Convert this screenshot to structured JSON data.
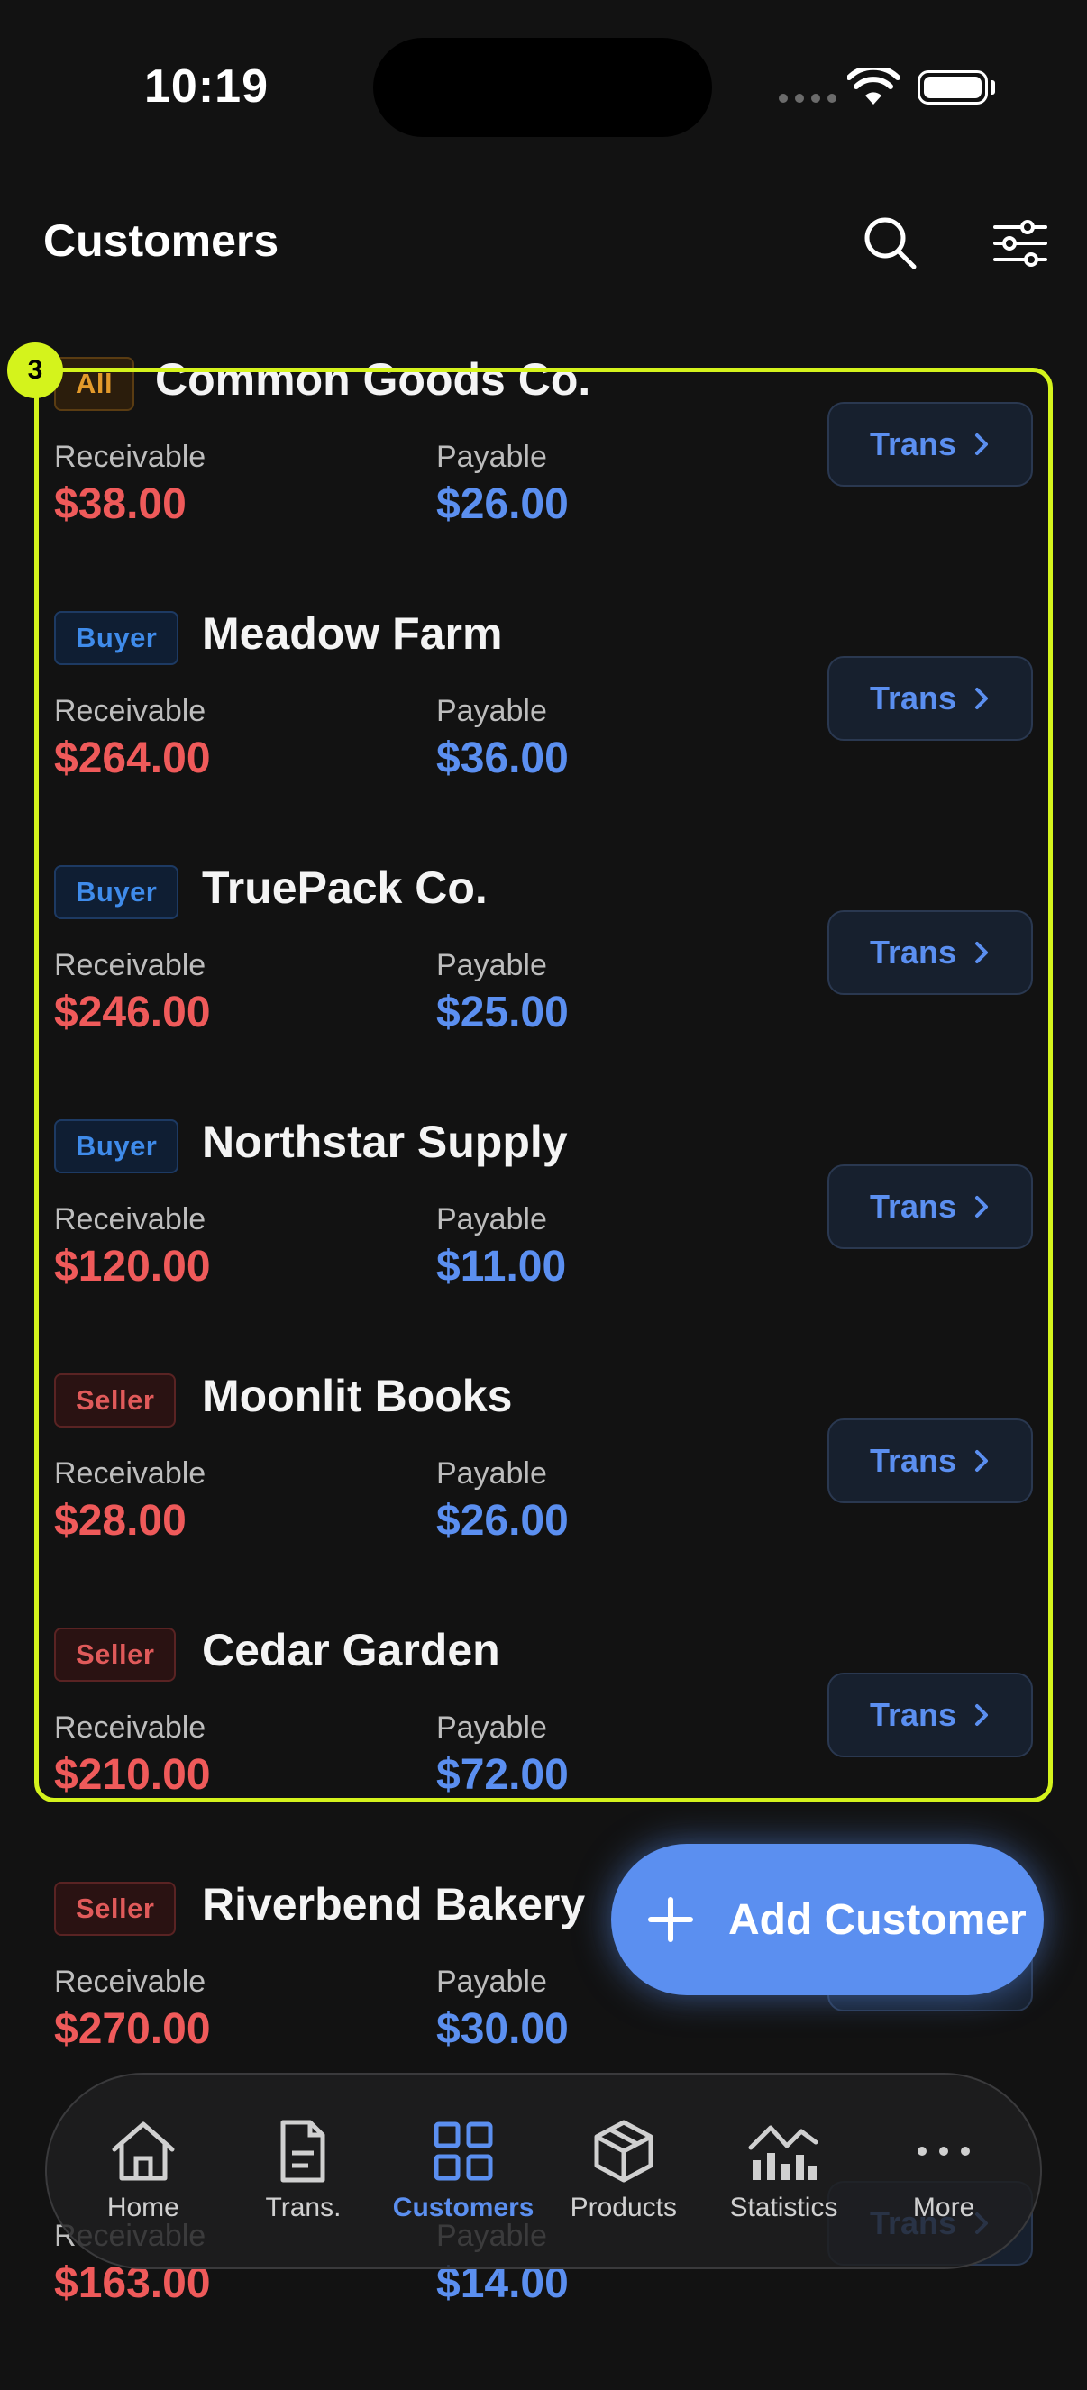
{
  "status_bar": {
    "time": "10:19"
  },
  "header": {
    "title": "Customers"
  },
  "labels": {
    "receivable": "Receivable",
    "payable": "Payable",
    "trans_button": "Trans"
  },
  "customers": [
    {
      "badge": "All",
      "type": "all",
      "name": "Common Goods Co.",
      "receivable": "$38.00",
      "payable": "$26.00"
    },
    {
      "badge": "Buyer",
      "type": "buyer",
      "name": "Meadow Farm",
      "receivable": "$264.00",
      "payable": "$36.00"
    },
    {
      "badge": "Buyer",
      "type": "buyer",
      "name": "TruePack Co.",
      "receivable": "$246.00",
      "payable": "$25.00"
    },
    {
      "badge": "Buyer",
      "type": "buyer",
      "name": "Northstar Supply",
      "receivable": "$120.00",
      "payable": "$11.00"
    },
    {
      "badge": "Seller",
      "type": "seller",
      "name": "Moonlit Books",
      "receivable": "$28.00",
      "payable": "$26.00"
    },
    {
      "badge": "Seller",
      "type": "seller",
      "name": "Cedar Garden",
      "receivable": "$210.00",
      "payable": "$72.00"
    },
    {
      "badge": "Seller",
      "type": "seller",
      "name": "Riverbend Bakery",
      "receivable": "$270.00",
      "payable": "$30.00"
    },
    {
      "badge": "",
      "type": "seller",
      "name": "",
      "receivable": "$163.00",
      "payable": "$14.00"
    }
  ],
  "highlight": {
    "label": "3"
  },
  "fab": {
    "label": "Add Customer"
  },
  "nav": {
    "active": "Customers",
    "items": [
      {
        "label": "Home",
        "icon": "home-icon"
      },
      {
        "label": "Trans.",
        "icon": "document-icon"
      },
      {
        "label": "Customers",
        "icon": "grid-icon"
      },
      {
        "label": "Products",
        "icon": "cube-icon"
      },
      {
        "label": "Statistics",
        "icon": "chart-icon"
      },
      {
        "label": "More",
        "icon": "more-icon"
      }
    ]
  },
  "colors": {
    "accent": "#5b8ff0",
    "receivable": "#ef5a5a",
    "highlight": "#d4f31c",
    "background": "#121212"
  }
}
